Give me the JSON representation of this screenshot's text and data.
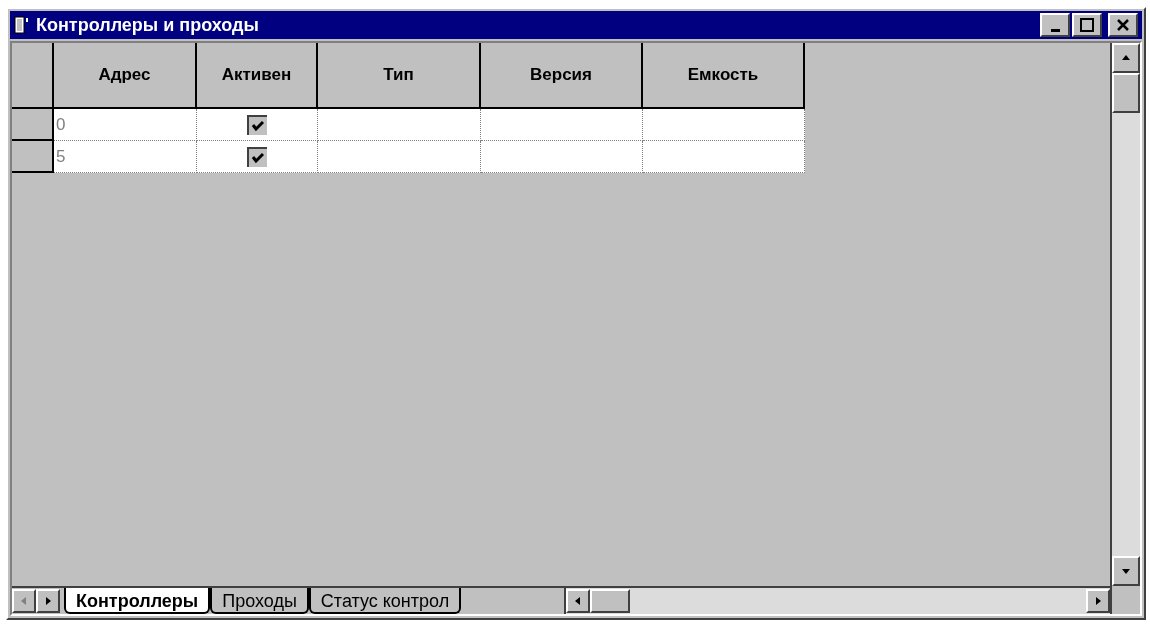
{
  "window": {
    "title": "Контроллеры и проходы"
  },
  "table": {
    "columns": [
      "Адрес",
      "Активен",
      "Тип",
      "Версия",
      "Емкость"
    ],
    "rows": [
      {
        "address": "0",
        "active": true
      },
      {
        "address": "5",
        "active": true
      }
    ]
  },
  "tabs": [
    {
      "label": "Контроллеры",
      "selected": true
    },
    {
      "label": "Проходы",
      "selected": false
    },
    {
      "label": "Статус контрол",
      "selected": false
    }
  ]
}
